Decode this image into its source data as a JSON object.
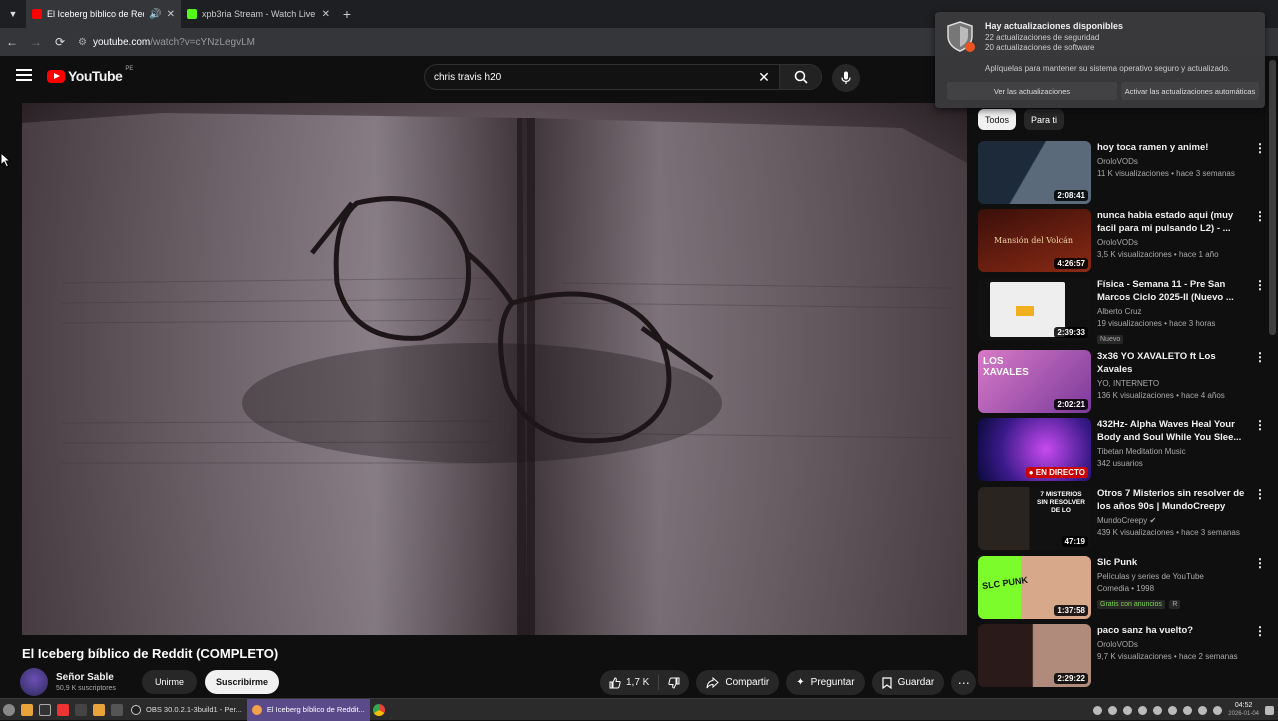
{
  "browser": {
    "tabs": [
      {
        "title": "El Iceberg bíblico de Redd",
        "active": true,
        "favicon_color": "#ff0000",
        "audio": true
      },
      {
        "title": "xpb3ria Stream - Watch Live",
        "active": false,
        "favicon_color": "#53fc18"
      }
    ],
    "url_host": "youtube.com",
    "url_path": "/watch?v=cYNzLegvLM"
  },
  "youtube": {
    "logo_text": "YouTube",
    "country_code": "PE",
    "search_query": "chris travis h20"
  },
  "video": {
    "title": "El Iceberg bíblico de Reddit (COMPLETO)",
    "channel_name": "Señor Sable",
    "subscribers": "50,9 K suscriptores",
    "join_label": "Unirme",
    "subscribe_label": "Suscribirme",
    "likes": "1,7 K",
    "share_label": "Compartir",
    "ask_label": "Preguntar",
    "save_label": "Guardar"
  },
  "chips": [
    "Todos",
    "Para ti"
  ],
  "recommendations": [
    {
      "title": "hoy toca ramen y anime!",
      "channel": "OroloVODs",
      "meta": "11 K visualizaciones • hace 3 semanas",
      "duration": "2:08:41",
      "thumb": [
        "#1c2a3a",
        "#5a6a7a"
      ]
    },
    {
      "title": "nunca habia estado aqui (muy facil para mi pulsando L2) - ...",
      "channel": "OroloVODs",
      "meta": "3,5 K visualizaciones • hace 1 año",
      "duration": "4:26:57",
      "thumb": [
        "#3a0f0a",
        "#8a2a14"
      ],
      "thumb_text": "Mansión del Volcán"
    },
    {
      "title": "Física - Semana 11 - Pre San Marcos Ciclo 2025-II (Nuevo ...",
      "channel": "Alberto Cruz",
      "meta": "19 visualizaciones • hace 3 horas",
      "duration": "2:39:33",
      "badge": "Nuevo",
      "thumb": [
        "#e8e8e8",
        "#222222"
      ]
    },
    {
      "title": "3x36 YO XAVALETO ft Los Xavales",
      "channel": "YO, INTERNETO",
      "meta": "136 K visualizaciones • hace 4 años",
      "duration": "2:02:21",
      "thumb": [
        "#c86ab8",
        "#7a3a9a"
      ],
      "thumb_text": "LOS XAVALES"
    },
    {
      "title": "432Hz- Alpha Waves Heal Your Body and Soul While You Slee...",
      "channel": "Tibetan Meditation Music",
      "meta": "342 usuarios",
      "live_label": "EN DIRECTO",
      "thumb": [
        "#1a0a5a",
        "#8a2ad8"
      ]
    },
    {
      "title": "Otros 7 Misterios sin resolver de los años 90s | MundoCreepy",
      "channel": "MundoCreepy",
      "meta": "439 K visualizaciones • hace 3 semanas",
      "duration": "47:19",
      "verified": true,
      "thumb": [
        "#111111",
        "#5a1010"
      ],
      "thumb_text": "7 MISTERIOS SIN RESOLVER DE LO"
    },
    {
      "title": "Slc Punk",
      "channel": "Películas y series de YouTube",
      "meta": "Comedia • 1998",
      "duration": "1:37:58",
      "badge": "Gratis con anuncios",
      "badge2": "R",
      "thumb": [
        "#7cfc2a",
        "#d8a88a"
      ],
      "thumb_text": "SLC PUNK"
    },
    {
      "title": "paco sanz ha vuelto?",
      "channel": "OroloVODs",
      "meta": "9,7 K visualizaciones • hace 2 semanas",
      "duration": "2:29:22",
      "thumb": [
        "#2a1a1a",
        "#b08a7a"
      ]
    }
  ],
  "notification": {
    "title": "Hay actualizaciones disponibles",
    "line1": "22 actualizaciones de seguridad",
    "line2": "20 actualizaciones de software",
    "body": "Aplíquelas para mantener su sistema operativo seguro y actualizado.",
    "btn_view": "Ver las actualizaciones",
    "btn_auto": "Activar las actualizaciones automáticas"
  },
  "taskbar": {
    "apps": [
      {
        "label": "OBS 30.0.2.1-3build1 - Per...",
        "active": false
      },
      {
        "label": "El Iceberg bíblico de Reddit...",
        "active": true
      }
    ],
    "time": "04:52",
    "date": "2026-01-04"
  },
  "colors": {
    "accent": "#ff0000",
    "page_bg": "#0f0f0f",
    "taskbar_active": "#5b4a8a"
  }
}
